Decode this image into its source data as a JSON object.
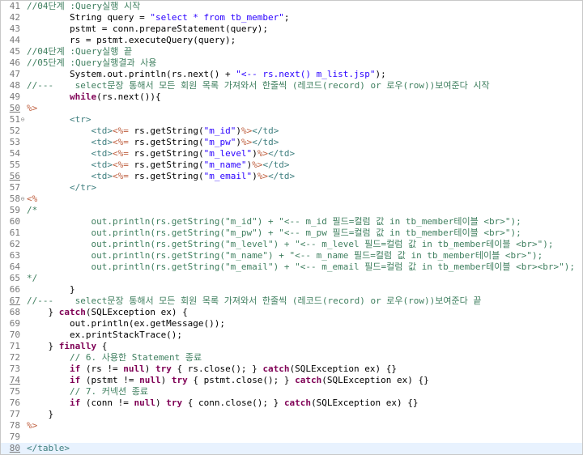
{
  "editor": {
    "fold_marker": "⊖",
    "current_line": 80,
    "lines": [
      {
        "n": "41",
        "tokens": [
          {
            "t": "//04단계 :Query실행 시작",
            "c": "com"
          }
        ]
      },
      {
        "n": "42",
        "tokens": [
          {
            "t": "        String query = ",
            "c": "plain"
          },
          {
            "t": "\"select * from tb_member\"",
            "c": "str"
          },
          {
            "t": ";",
            "c": "plain"
          }
        ]
      },
      {
        "n": "43",
        "tokens": [
          {
            "t": "        pstmt = conn.prepareStatement(query);",
            "c": "plain"
          }
        ]
      },
      {
        "n": "44",
        "tokens": [
          {
            "t": "        rs = pstmt.executeQuery(query);",
            "c": "plain"
          }
        ]
      },
      {
        "n": "45",
        "tokens": [
          {
            "t": "//04단계 :Query실행 끝",
            "c": "com"
          }
        ]
      },
      {
        "n": "46",
        "tokens": [
          {
            "t": "//05단계 :Query실행결과 사용",
            "c": "com"
          }
        ]
      },
      {
        "n": "47",
        "tokens": [
          {
            "t": "        System.out.println(rs.next() + ",
            "c": "plain"
          },
          {
            "t": "\"<-- rs.next() m_list.jsp\"",
            "c": "str"
          },
          {
            "t": ");",
            "c": "plain"
          }
        ]
      },
      {
        "n": "48",
        "tokens": [
          {
            "t": "//---    select문장 통해서 모든 회원 목록 가져와서 한줄씩 (레코드(record) or 로우(row))보여준다 시작",
            "c": "com"
          }
        ]
      },
      {
        "n": "49",
        "tokens": [
          {
            "t": "        ",
            "c": "plain"
          },
          {
            "t": "while",
            "c": "kw"
          },
          {
            "t": "(rs.next()){",
            "c": "plain"
          }
        ]
      },
      {
        "n": "50",
        "ul": true,
        "tokens": [
          {
            "t": "%>",
            "c": "jsp"
          }
        ]
      },
      {
        "n": "51",
        "fold": true,
        "tokens": [
          {
            "t": "        ",
            "c": "plain"
          },
          {
            "t": "<tr>",
            "c": "tag"
          }
        ]
      },
      {
        "n": "52",
        "tokens": [
          {
            "t": "            ",
            "c": "plain"
          },
          {
            "t": "<td>",
            "c": "tag"
          },
          {
            "t": "<%=",
            "c": "jsp"
          },
          {
            "t": " rs.getString(",
            "c": "plain"
          },
          {
            "t": "\"m_id\"",
            "c": "str"
          },
          {
            "t": ")",
            "c": "plain"
          },
          {
            "t": "%>",
            "c": "jsp"
          },
          {
            "t": "</td>",
            "c": "tag"
          }
        ]
      },
      {
        "n": "53",
        "tokens": [
          {
            "t": "            ",
            "c": "plain"
          },
          {
            "t": "<td>",
            "c": "tag"
          },
          {
            "t": "<%=",
            "c": "jsp"
          },
          {
            "t": " rs.getString(",
            "c": "plain"
          },
          {
            "t": "\"m_pw\"",
            "c": "str"
          },
          {
            "t": ")",
            "c": "plain"
          },
          {
            "t": "%>",
            "c": "jsp"
          },
          {
            "t": "</td>",
            "c": "tag"
          }
        ]
      },
      {
        "n": "54",
        "tokens": [
          {
            "t": "            ",
            "c": "plain"
          },
          {
            "t": "<td>",
            "c": "tag"
          },
          {
            "t": "<%=",
            "c": "jsp"
          },
          {
            "t": " rs.getString(",
            "c": "plain"
          },
          {
            "t": "\"m_level\"",
            "c": "str"
          },
          {
            "t": ")",
            "c": "plain"
          },
          {
            "t": "%>",
            "c": "jsp"
          },
          {
            "t": "</td>",
            "c": "tag"
          }
        ]
      },
      {
        "n": "55",
        "tokens": [
          {
            "t": "            ",
            "c": "plain"
          },
          {
            "t": "<td>",
            "c": "tag"
          },
          {
            "t": "<%=",
            "c": "jsp"
          },
          {
            "t": " rs.getString(",
            "c": "plain"
          },
          {
            "t": "\"m_name\"",
            "c": "str"
          },
          {
            "t": ")",
            "c": "plain"
          },
          {
            "t": "%>",
            "c": "jsp"
          },
          {
            "t": "</td>",
            "c": "tag"
          }
        ]
      },
      {
        "n": "56",
        "ul": true,
        "tokens": [
          {
            "t": "            ",
            "c": "plain"
          },
          {
            "t": "<td>",
            "c": "tag"
          },
          {
            "t": "<%=",
            "c": "jsp"
          },
          {
            "t": " rs.getString(",
            "c": "plain"
          },
          {
            "t": "\"m_email\"",
            "c": "str"
          },
          {
            "t": ")",
            "c": "plain"
          },
          {
            "t": "%>",
            "c": "jsp"
          },
          {
            "t": "</td>",
            "c": "tag"
          }
        ]
      },
      {
        "n": "57",
        "tokens": [
          {
            "t": "        ",
            "c": "plain"
          },
          {
            "t": "</tr>",
            "c": "tag"
          }
        ]
      },
      {
        "n": "58",
        "fold": true,
        "tokens": [
          {
            "t": "<%",
            "c": "jsp"
          }
        ]
      },
      {
        "n": "59",
        "tokens": [
          {
            "t": "/*",
            "c": "com"
          }
        ]
      },
      {
        "n": "60",
        "tokens": [
          {
            "t": "            out.println(rs.getString(\"m_id\") + \"<-- m_id 필드=컬럼 값 in tb_member테이블 <br>\");",
            "c": "com"
          }
        ]
      },
      {
        "n": "61",
        "tokens": [
          {
            "t": "            out.println(rs.getString(\"m_pw\") + \"<-- m_pw 필드=컬럼 값 in tb_member테이블 <br>\");",
            "c": "com"
          }
        ]
      },
      {
        "n": "62",
        "tokens": [
          {
            "t": "            out.println(rs.getString(\"m_level\") + \"<-- m_level 필드=컬럼 값 in tb_member테이블 <br>\");",
            "c": "com"
          }
        ]
      },
      {
        "n": "63",
        "tokens": [
          {
            "t": "            out.println(rs.getString(\"m_name\") + \"<-- m_name 필드=컬럼 값 in tb_member테이블 <br>\");",
            "c": "com"
          }
        ]
      },
      {
        "n": "64",
        "tokens": [
          {
            "t": "            out.println(rs.getString(\"m_email\") + \"<-- m_email 필드=컬럼 값 in tb_member테이블 <br><br>\");",
            "c": "com"
          }
        ]
      },
      {
        "n": "65",
        "tokens": [
          {
            "t": "*/",
            "c": "com"
          }
        ]
      },
      {
        "n": "66",
        "tokens": [
          {
            "t": "        }",
            "c": "plain"
          }
        ]
      },
      {
        "n": "67",
        "ul": true,
        "tokens": [
          {
            "t": "//---    select문장 통해서 모든 회원 목록 가져와서 한줄씩 (레코드(record) or 로우(row))보여준다 끝",
            "c": "com"
          }
        ]
      },
      {
        "n": "68",
        "tokens": [
          {
            "t": "    } ",
            "c": "plain"
          },
          {
            "t": "catch",
            "c": "kw"
          },
          {
            "t": "(SQLException ex) {",
            "c": "plain"
          }
        ]
      },
      {
        "n": "69",
        "tokens": [
          {
            "t": "        out.println(ex.getMessage());",
            "c": "plain"
          }
        ]
      },
      {
        "n": "70",
        "tokens": [
          {
            "t": "        ex.printStackTrace();",
            "c": "plain"
          }
        ]
      },
      {
        "n": "71",
        "tokens": [
          {
            "t": "    } ",
            "c": "plain"
          },
          {
            "t": "finally",
            "c": "kw"
          },
          {
            "t": " {",
            "c": "plain"
          }
        ]
      },
      {
        "n": "72",
        "tokens": [
          {
            "t": "        ",
            "c": "plain"
          },
          {
            "t": "// 6. 사용한 Statement 종료",
            "c": "com"
          }
        ]
      },
      {
        "n": "73",
        "tokens": [
          {
            "t": "        ",
            "c": "plain"
          },
          {
            "t": "if",
            "c": "kw"
          },
          {
            "t": " (rs != ",
            "c": "plain"
          },
          {
            "t": "null",
            "c": "kw"
          },
          {
            "t": ") ",
            "c": "plain"
          },
          {
            "t": "try",
            "c": "kw"
          },
          {
            "t": " { rs.close(); } ",
            "c": "plain"
          },
          {
            "t": "catch",
            "c": "kw"
          },
          {
            "t": "(SQLException ex) {}",
            "c": "plain"
          }
        ]
      },
      {
        "n": "74",
        "ul": true,
        "tokens": [
          {
            "t": "        ",
            "c": "plain"
          },
          {
            "t": "if",
            "c": "kw"
          },
          {
            "t": " (pstmt != ",
            "c": "plain"
          },
          {
            "t": "null",
            "c": "kw"
          },
          {
            "t": ") ",
            "c": "plain"
          },
          {
            "t": "try",
            "c": "kw"
          },
          {
            "t": " { pstmt.close(); } ",
            "c": "plain"
          },
          {
            "t": "catch",
            "c": "kw"
          },
          {
            "t": "(SQLException ex) {}",
            "c": "plain"
          }
        ]
      },
      {
        "n": "75",
        "tokens": [
          {
            "t": "        ",
            "c": "plain"
          },
          {
            "t": "// 7. 커넥션 종료",
            "c": "com"
          }
        ]
      },
      {
        "n": "76",
        "tokens": [
          {
            "t": "        ",
            "c": "plain"
          },
          {
            "t": "if",
            "c": "kw"
          },
          {
            "t": " (conn != ",
            "c": "plain"
          },
          {
            "t": "null",
            "c": "kw"
          },
          {
            "t": ") ",
            "c": "plain"
          },
          {
            "t": "try",
            "c": "kw"
          },
          {
            "t": " { conn.close(); } ",
            "c": "plain"
          },
          {
            "t": "catch",
            "c": "kw"
          },
          {
            "t": "(SQLException ex) {}",
            "c": "plain"
          }
        ]
      },
      {
        "n": "77",
        "tokens": [
          {
            "t": "    }",
            "c": "plain"
          }
        ]
      },
      {
        "n": "78",
        "tokens": [
          {
            "t": "%>",
            "c": "jsp"
          }
        ]
      },
      {
        "n": "79",
        "tokens": []
      },
      {
        "n": "80",
        "ul": true,
        "tokens": [
          {
            "t": "</table>",
            "c": "tag"
          }
        ]
      }
    ]
  }
}
